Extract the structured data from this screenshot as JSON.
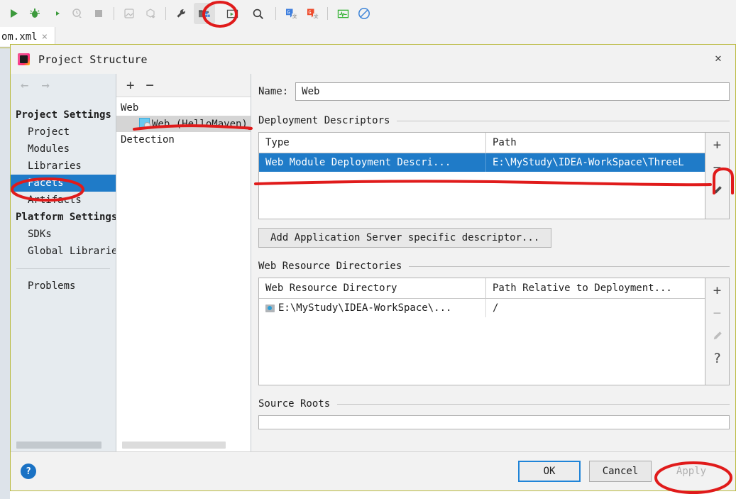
{
  "ide": {
    "toolbar_icons": [
      {
        "name": "run-icon",
        "glyph": "▶",
        "color": "#3c9a3c",
        "active": false
      },
      {
        "name": "debug-icon",
        "glyph": "bug",
        "color": "#3c9a3c",
        "active": false
      },
      {
        "name": "run-with-coverage-icon",
        "glyph": "coverage",
        "color": "#3c3c3c",
        "active": false
      },
      {
        "name": "profile-icon",
        "glyph": "profile",
        "color": "#b8b8b8",
        "active": false
      },
      {
        "name": "stop-icon",
        "glyph": "■",
        "color": "#b0b0b0",
        "active": false
      },
      {
        "name": "separator-1",
        "glyph": "sep",
        "color": "",
        "active": false
      },
      {
        "name": "update-project-icon",
        "glyph": "update",
        "color": "#b8b8b8",
        "active": false
      },
      {
        "name": "commit-icon",
        "glyph": "commit",
        "color": "#b8b8b8",
        "active": false
      },
      {
        "name": "separator-2",
        "glyph": "sep",
        "color": "",
        "active": false
      },
      {
        "name": "settings-wrench-icon",
        "glyph": "wrench",
        "color": "#4a4a4a",
        "active": false
      },
      {
        "name": "project-structure-icon",
        "glyph": "structure",
        "color": "#5c5c5c",
        "active": true
      },
      {
        "name": "run-configurations-icon",
        "glyph": "window",
        "color": "#4a8a4a",
        "active": false
      },
      {
        "name": "search-everywhere-icon",
        "glyph": "search",
        "color": "#3c3c3c",
        "active": false
      },
      {
        "name": "separator-3",
        "glyph": "sep",
        "color": "",
        "active": false
      },
      {
        "name": "translate-blue-icon",
        "glyph": "translate-blue",
        "color": "#3d7ede",
        "active": false
      },
      {
        "name": "translate-orange-icon",
        "glyph": "translate-orange",
        "color": "#ee4b2b",
        "active": false
      },
      {
        "name": "separator-4",
        "glyph": "sep",
        "color": "",
        "active": false
      },
      {
        "name": "monitor-icon",
        "glyph": "monitor",
        "color": "#33b233",
        "active": false
      },
      {
        "name": "disable-icon",
        "glyph": "⊘",
        "color": "#3d84d8",
        "active": false
      }
    ],
    "tab": {
      "label": "om.xml",
      "close_glyph": "×"
    }
  },
  "dialog": {
    "title": "Project Structure",
    "close_glyph": "✕",
    "app_icon": "intellij-idea-icon"
  },
  "sidebar": {
    "back_glyph": "←",
    "forward_glyph": "→",
    "groups": [
      {
        "label": "Project Settings",
        "items": [
          {
            "label": "Project",
            "selected": false
          },
          {
            "label": "Modules",
            "selected": false
          },
          {
            "label": "Libraries",
            "selected": false
          },
          {
            "label": "Facets",
            "selected": true
          },
          {
            "label": "Artifacts",
            "selected": false
          }
        ]
      },
      {
        "label": "Platform Settings",
        "items": [
          {
            "label": "SDKs",
            "selected": false
          },
          {
            "label": "Global Libraries",
            "selected": false
          }
        ]
      }
    ],
    "footer_item": {
      "label": "Problems",
      "selected": false
    }
  },
  "facets_panel": {
    "add_glyph": "+",
    "remove_glyph": "−",
    "tree": [
      {
        "label": "Web",
        "level": 0,
        "selected": false,
        "icon": null
      },
      {
        "label": "Web (HelloMaven)",
        "level": 1,
        "selected": true,
        "icon": "web-module-icon"
      },
      {
        "label": "Detection",
        "level": 0,
        "selected": false,
        "icon": null
      }
    ]
  },
  "detail": {
    "name_label": "Name:",
    "name_value": "Web",
    "deployment_descriptors": {
      "title": "Deployment Descriptors",
      "columns": [
        "Type",
        "Path"
      ],
      "rows": [
        {
          "type": "Web Module Deployment Descri...",
          "path": "E:\\MyStudy\\IDEA-WorkSpace\\ThreeL",
          "selected": true
        }
      ],
      "side_buttons": [
        {
          "name": "add-descriptor-button",
          "glyph": "+",
          "disabled": false
        },
        {
          "name": "remove-descriptor-button",
          "glyph": "−",
          "disabled": false
        },
        {
          "name": "edit-descriptor-button",
          "glyph": "pencil",
          "disabled": false
        }
      ]
    },
    "add_server_descriptor_button": "Add Application Server specific descriptor...",
    "web_resource_directories": {
      "title": "Web Resource Directories",
      "columns": [
        "Web Resource Directory",
        "Path Relative to Deployment..."
      ],
      "rows": [
        {
          "directory": "E:\\MyStudy\\IDEA-WorkSpace\\...",
          "relative_path": "/",
          "selected": false
        }
      ],
      "side_buttons": [
        {
          "name": "add-resource-dir-button",
          "glyph": "+",
          "disabled": false
        },
        {
          "name": "remove-resource-dir-button",
          "glyph": "−",
          "disabled": true
        },
        {
          "name": "edit-resource-dir-button",
          "glyph": "pencil",
          "disabled": true
        },
        {
          "name": "resource-dir-help-button",
          "glyph": "?",
          "disabled": false
        }
      ]
    },
    "source_roots": {
      "title": "Source Roots",
      "value": ""
    }
  },
  "footer": {
    "help_glyph": "?",
    "buttons": [
      {
        "name": "ok-button",
        "label": "OK",
        "style": "primary",
        "disabled": false
      },
      {
        "name": "cancel-button",
        "label": "Cancel",
        "style": "normal",
        "disabled": false
      },
      {
        "name": "apply-button",
        "label": "Apply",
        "style": "disabled",
        "disabled": true
      }
    ]
  },
  "annotations": {
    "accent_color": "#e01b1b",
    "marks": [
      {
        "name": "annotation-circle-toolbar-project-structure",
        "shape": "ellipse"
      },
      {
        "name": "annotation-underline-web-hellomaven",
        "shape": "line"
      },
      {
        "name": "annotation-circle-facets",
        "shape": "ellipse"
      },
      {
        "name": "annotation-underline-descriptor-row",
        "shape": "line"
      },
      {
        "name": "annotation-circle-remove-descriptor",
        "shape": "ellipse"
      },
      {
        "name": "annotation-circle-apply",
        "shape": "ellipse"
      }
    ]
  }
}
